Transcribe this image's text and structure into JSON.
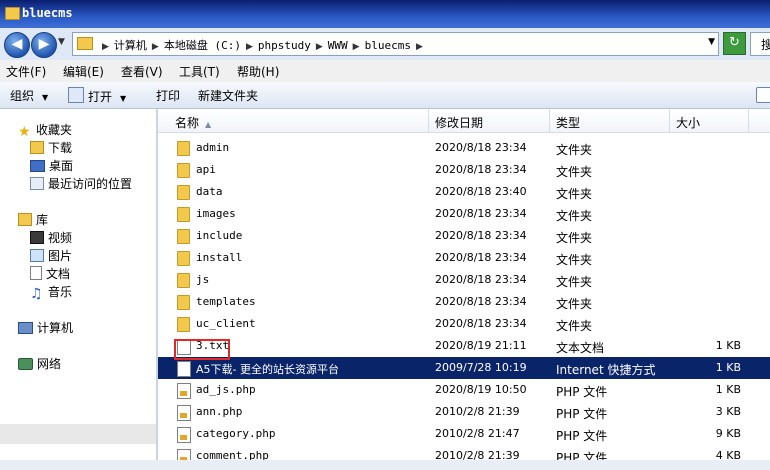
{
  "window": {
    "title": "bluecms"
  },
  "address": {
    "segments": [
      "计算机",
      "本地磁盘 (C:)",
      "phpstudy",
      "WWW",
      "bluecms"
    ],
    "search_partial": "搜"
  },
  "menu": [
    "文件(F)",
    "编辑(E)",
    "查看(V)",
    "工具(T)",
    "帮助(H)"
  ],
  "toolbar": {
    "organize": "组织",
    "open": "打开",
    "print": "打印",
    "new_folder": "新建文件夹"
  },
  "nav": {
    "favorites": "收藏夹",
    "downloads": "下载",
    "desktop": "桌面",
    "recent": "最近访问的位置",
    "libraries": "库",
    "videos": "视频",
    "pictures": "图片",
    "documents": "文档",
    "music": "音乐",
    "computer": "计算机",
    "network": "网络"
  },
  "columns": {
    "name": "名称",
    "modified": "修改日期",
    "type": "类型",
    "size": "大小"
  },
  "files": [
    {
      "name": "admin",
      "date": "2020/8/18 23:34",
      "type": "文件夹",
      "size": "",
      "icon": "folder"
    },
    {
      "name": "api",
      "date": "2020/8/18 23:34",
      "type": "文件夹",
      "size": "",
      "icon": "folder"
    },
    {
      "name": "data",
      "date": "2020/8/18 23:40",
      "type": "文件夹",
      "size": "",
      "icon": "folder"
    },
    {
      "name": "images",
      "date": "2020/8/18 23:34",
      "type": "文件夹",
      "size": "",
      "icon": "folder"
    },
    {
      "name": "include",
      "date": "2020/8/18 23:34",
      "type": "文件夹",
      "size": "",
      "icon": "folder"
    },
    {
      "name": "install",
      "date": "2020/8/18 23:34",
      "type": "文件夹",
      "size": "",
      "icon": "folder"
    },
    {
      "name": "js",
      "date": "2020/8/18 23:34",
      "type": "文件夹",
      "size": "",
      "icon": "folder"
    },
    {
      "name": "templates",
      "date": "2020/8/18 23:34",
      "type": "文件夹",
      "size": "",
      "icon": "folder"
    },
    {
      "name": "uc_client",
      "date": "2020/8/18 23:34",
      "type": "文件夹",
      "size": "",
      "icon": "folder"
    },
    {
      "name": "3.txt",
      "date": "2020/8/19 21:11",
      "type": "文本文档",
      "size": "1 KB",
      "icon": "txt"
    },
    {
      "name": "A5下载- 更全的站长资源平台",
      "date": "2009/7/28 10:19",
      "type": "Internet 快捷方式",
      "size": "1 KB",
      "icon": "shortcut"
    },
    {
      "name": "ad_js.php",
      "date": "2020/8/19 10:50",
      "type": "PHP 文件",
      "size": "1 KB",
      "icon": "php"
    },
    {
      "name": "ann.php",
      "date": "2010/2/8 21:39",
      "type": "PHP 文件",
      "size": "3 KB",
      "icon": "php"
    },
    {
      "name": "category.php",
      "date": "2010/2/8 21:47",
      "type": "PHP 文件",
      "size": "9 KB",
      "icon": "php"
    },
    {
      "name": "comment.php",
      "date": "2010/2/8 21:39",
      "type": "PHP 文件",
      "size": "4 KB",
      "icon": "php"
    }
  ],
  "colors": {
    "selection": "#0a246a",
    "highlight_border": "#e02a2a",
    "titlebar": "#1f4fb8"
  }
}
